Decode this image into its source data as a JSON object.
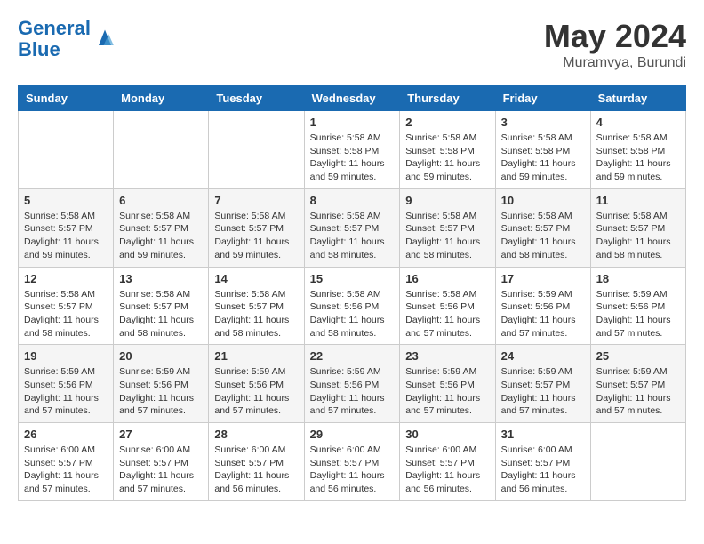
{
  "header": {
    "logo_line1": "General",
    "logo_line2": "Blue",
    "month": "May 2024",
    "location": "Muramvya, Burundi"
  },
  "weekdays": [
    "Sunday",
    "Monday",
    "Tuesday",
    "Wednesday",
    "Thursday",
    "Friday",
    "Saturday"
  ],
  "weeks": [
    [
      {
        "day": "",
        "info": ""
      },
      {
        "day": "",
        "info": ""
      },
      {
        "day": "",
        "info": ""
      },
      {
        "day": "1",
        "info": "Sunrise: 5:58 AM\nSunset: 5:58 PM\nDaylight: 11 hours\nand 59 minutes."
      },
      {
        "day": "2",
        "info": "Sunrise: 5:58 AM\nSunset: 5:58 PM\nDaylight: 11 hours\nand 59 minutes."
      },
      {
        "day": "3",
        "info": "Sunrise: 5:58 AM\nSunset: 5:58 PM\nDaylight: 11 hours\nand 59 minutes."
      },
      {
        "day": "4",
        "info": "Sunrise: 5:58 AM\nSunset: 5:58 PM\nDaylight: 11 hours\nand 59 minutes."
      }
    ],
    [
      {
        "day": "5",
        "info": "Sunrise: 5:58 AM\nSunset: 5:57 PM\nDaylight: 11 hours\nand 59 minutes."
      },
      {
        "day": "6",
        "info": "Sunrise: 5:58 AM\nSunset: 5:57 PM\nDaylight: 11 hours\nand 59 minutes."
      },
      {
        "day": "7",
        "info": "Sunrise: 5:58 AM\nSunset: 5:57 PM\nDaylight: 11 hours\nand 59 minutes."
      },
      {
        "day": "8",
        "info": "Sunrise: 5:58 AM\nSunset: 5:57 PM\nDaylight: 11 hours\nand 58 minutes."
      },
      {
        "day": "9",
        "info": "Sunrise: 5:58 AM\nSunset: 5:57 PM\nDaylight: 11 hours\nand 58 minutes."
      },
      {
        "day": "10",
        "info": "Sunrise: 5:58 AM\nSunset: 5:57 PM\nDaylight: 11 hours\nand 58 minutes."
      },
      {
        "day": "11",
        "info": "Sunrise: 5:58 AM\nSunset: 5:57 PM\nDaylight: 11 hours\nand 58 minutes."
      }
    ],
    [
      {
        "day": "12",
        "info": "Sunrise: 5:58 AM\nSunset: 5:57 PM\nDaylight: 11 hours\nand 58 minutes."
      },
      {
        "day": "13",
        "info": "Sunrise: 5:58 AM\nSunset: 5:57 PM\nDaylight: 11 hours\nand 58 minutes."
      },
      {
        "day": "14",
        "info": "Sunrise: 5:58 AM\nSunset: 5:57 PM\nDaylight: 11 hours\nand 58 minutes."
      },
      {
        "day": "15",
        "info": "Sunrise: 5:58 AM\nSunset: 5:56 PM\nDaylight: 11 hours\nand 58 minutes."
      },
      {
        "day": "16",
        "info": "Sunrise: 5:58 AM\nSunset: 5:56 PM\nDaylight: 11 hours\nand 57 minutes."
      },
      {
        "day": "17",
        "info": "Sunrise: 5:59 AM\nSunset: 5:56 PM\nDaylight: 11 hours\nand 57 minutes."
      },
      {
        "day": "18",
        "info": "Sunrise: 5:59 AM\nSunset: 5:56 PM\nDaylight: 11 hours\nand 57 minutes."
      }
    ],
    [
      {
        "day": "19",
        "info": "Sunrise: 5:59 AM\nSunset: 5:56 PM\nDaylight: 11 hours\nand 57 minutes."
      },
      {
        "day": "20",
        "info": "Sunrise: 5:59 AM\nSunset: 5:56 PM\nDaylight: 11 hours\nand 57 minutes."
      },
      {
        "day": "21",
        "info": "Sunrise: 5:59 AM\nSunset: 5:56 PM\nDaylight: 11 hours\nand 57 minutes."
      },
      {
        "day": "22",
        "info": "Sunrise: 5:59 AM\nSunset: 5:56 PM\nDaylight: 11 hours\nand 57 minutes."
      },
      {
        "day": "23",
        "info": "Sunrise: 5:59 AM\nSunset: 5:56 PM\nDaylight: 11 hours\nand 57 minutes."
      },
      {
        "day": "24",
        "info": "Sunrise: 5:59 AM\nSunset: 5:57 PM\nDaylight: 11 hours\nand 57 minutes."
      },
      {
        "day": "25",
        "info": "Sunrise: 5:59 AM\nSunset: 5:57 PM\nDaylight: 11 hours\nand 57 minutes."
      }
    ],
    [
      {
        "day": "26",
        "info": "Sunrise: 6:00 AM\nSunset: 5:57 PM\nDaylight: 11 hours\nand 57 minutes."
      },
      {
        "day": "27",
        "info": "Sunrise: 6:00 AM\nSunset: 5:57 PM\nDaylight: 11 hours\nand 57 minutes."
      },
      {
        "day": "28",
        "info": "Sunrise: 6:00 AM\nSunset: 5:57 PM\nDaylight: 11 hours\nand 56 minutes."
      },
      {
        "day": "29",
        "info": "Sunrise: 6:00 AM\nSunset: 5:57 PM\nDaylight: 11 hours\nand 56 minutes."
      },
      {
        "day": "30",
        "info": "Sunrise: 6:00 AM\nSunset: 5:57 PM\nDaylight: 11 hours\nand 56 minutes."
      },
      {
        "day": "31",
        "info": "Sunrise: 6:00 AM\nSunset: 5:57 PM\nDaylight: 11 hours\nand 56 minutes."
      },
      {
        "day": "",
        "info": ""
      }
    ]
  ]
}
